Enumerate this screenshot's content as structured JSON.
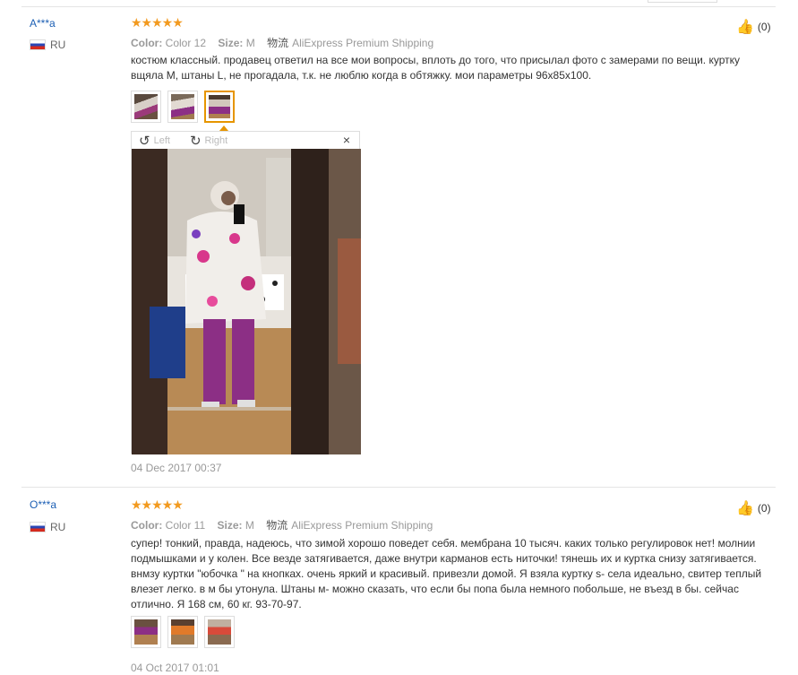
{
  "reviews": [
    {
      "user": "A***a",
      "country": "RU",
      "rating": "★★★★★",
      "color_label": "Color:",
      "color_value": "Color 12",
      "size_label": "Size:",
      "size_value": "M",
      "shipping_prefix": "物流",
      "shipping": "AliExpress Premium Shipping",
      "text": "костюм классный. продавец ответил на все мои вопросы, вплоть до того, что присылал фото с замерами по вещи. куртку вщяла М, штаны L, не прогадала, т.к. не люблю когда в обтяжку. мои параметры 96х85х100.",
      "likes": "(0)",
      "date": "04 Dec 2017 00:37",
      "viewer": {
        "rotate_left": "Left",
        "rotate_right": "Right",
        "close": "×"
      }
    },
    {
      "user": "O***a",
      "country": "RU",
      "rating": "★★★★★",
      "color_label": "Color:",
      "color_value": "Color 11",
      "size_label": "Size:",
      "size_value": "M",
      "shipping_prefix": "物流",
      "shipping": "AliExpress Premium Shipping",
      "text": "супер! тонкий, правда, надеюсь, что зимой хорошо поведет себя. мембрана 10 тысяч. каких только регулировок нет! молнии подмышками и у колен. Все везде затягивается, даже внутри карманов есть ниточки! тянешь их и куртка снизу затягивается. внмзу куртки \"юбочка \" на кнопках. очень яркий и красивый. привезли домой. Я взяла куртку s- села идеально, свитер теплый влезет легко. в м бы утонула. Штаны м- можно сказать, что если бы попа была немного побольше, не въезд в бы. сейчас отлично. Я 168 см, 60 кг. 93-70-97.",
      "likes": "(0)",
      "date": "04 Oct 2017 01:01"
    }
  ]
}
